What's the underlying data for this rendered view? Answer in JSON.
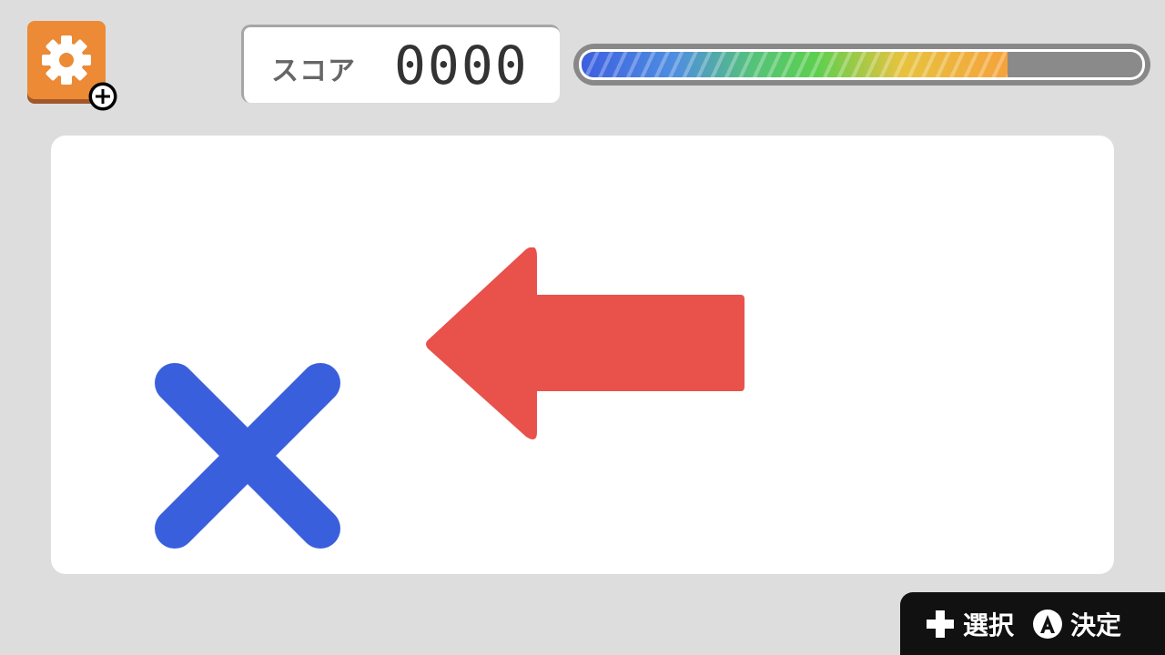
{
  "hud": {
    "score_label": "スコア",
    "score_value": "0000",
    "progress_fraction": 0.76
  },
  "icons": {
    "settings": "gear-icon",
    "settings_badge": "plus-icon",
    "prompt": "left-arrow-icon",
    "wrong": "cross-icon",
    "select_button": "dpad-plus-icon",
    "confirm_button": "a-button-icon"
  },
  "colors": {
    "settings_button": "#ec8a35",
    "arrow": "#e9514b",
    "cross": "#3a5fdd",
    "background": "#dcdddc",
    "controls_bar": "#111111"
  },
  "controls": {
    "select_label": "選択",
    "confirm_label": "決定"
  }
}
